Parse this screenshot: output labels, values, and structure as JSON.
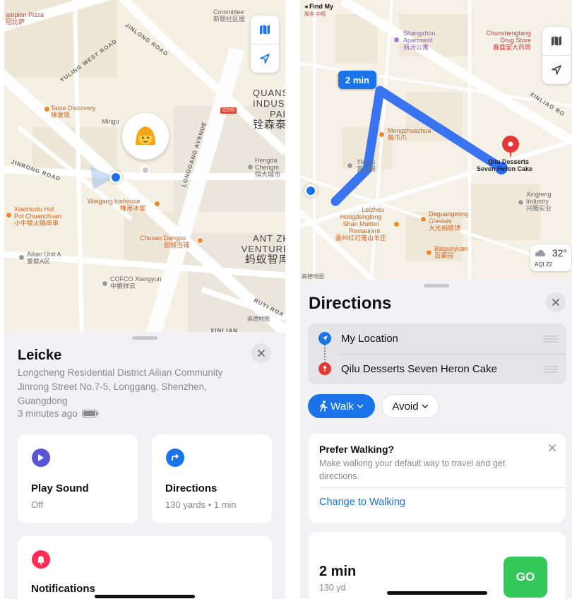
{
  "left": {
    "map": {
      "labels": {
        "pizza": "ampion Pizza",
        "pizza_cn": "冠比萨",
        "committee": "Committee",
        "committee_cn": "新联社区居",
        "yuling_road": "YULING WEST ROAD",
        "jinlong_road": "JINLONG ROAD",
        "taste_discovery": "Taste Discovery",
        "taste_discovery_cn": "味发现",
        "mingu": "Mingu",
        "road_badge": "G205",
        "longgang_ave": "LONGGANG AVENUE",
        "quans": "QUANS",
        "indus": "INDUS",
        "pai": "PAI",
        "quans_cn": "铨森泰",
        "hengda": "Hengda",
        "hengda_2": "Chengm",
        "hengda_cn": "恒大城市",
        "jinrong_road": "JINRONG ROAD",
        "weigang": "Weigang Icehouse",
        "weigang_cn": "唯港冰室",
        "xiaoniudu": "Xiaoniudu Hot",
        "xiaoniudu_2": "Pot Chuanchuan",
        "xiaoniudu_cn": "小牛犊火锅串串",
        "chusao": "Chusao Dangpu",
        "chusao_cn": "厨嫂当铺",
        "ailian": "Ailian Unit A",
        "ailian_cn": "爱联A区",
        "antzh": "ANT ZH",
        "venture": "VENTURE",
        "ant_cn": "蚂蚁智库",
        "cofco": "COFCO Xiangyun",
        "cofco_cn": "中粮祥云",
        "ruyi_road": "RUYI ROA",
        "xinlian": "XINLIAN",
        "attribution": "高德地图"
      }
    },
    "device": {
      "name": "Leicke",
      "address": "Longcheng Residential District Ailian Community Jinrong Street No.7-5, Longgang, Shenzhen, Guangdong",
      "time": "3 minutes ago"
    },
    "cards": {
      "play_sound": {
        "title": "Play Sound",
        "sub": "Off"
      },
      "directions": {
        "title": "Directions",
        "sub": "130 yards • 1 min"
      },
      "notifications": {
        "title": "Notifications"
      }
    },
    "colors": {
      "accent": "#1a73e8",
      "sound": "#5856d6",
      "notify": "#ff2d55"
    }
  },
  "right": {
    "map": {
      "back": "◂ Find My",
      "back_sub": "服务·中枢",
      "labels": {
        "shangzhou": "Shangzhou",
        "shangzhou_2": "Apartment",
        "shangzhou_cn": "商洲公寓",
        "chunsheng": "Chunshengtang",
        "chunsheng_2": "Drug Store",
        "chunsheng_cn": "春盛堂大药房",
        "xinliao_road": "XINLIAO RO",
        "mengzhua": "Mengzhuazhua",
        "mengzhua_cn": "萌爪爪",
        "qilu": "Qilu Desserts",
        "qilu_2": "Seven Heron Cake",
        "yixin": "Yixinju",
        "yixin_cn": "宜欣居",
        "xingteng": "Xingteng",
        "xingteng_2": "Industry",
        "xingteng_cn": "兴腾实业",
        "leizhou": "Leizhou",
        "leizhou_2": "Hongdenglong",
        "leizhou_3": "Shan Mutton",
        "leizhou_4": "Restaurant",
        "leizhou_cn": "雷州红灯笼山羊庄",
        "daguang": "Daguangming",
        "daguang_2": "Glasses",
        "daguang_cn": "大光明眼镜",
        "baiguo": "Baiguoyuan",
        "baiguo_cn": "百果园",
        "attribution": "高德地图"
      },
      "time_badge": "2 min",
      "weather": {
        "temp": "32°",
        "aqi": "AQI 22"
      }
    },
    "directions": {
      "title": "Directions",
      "from": "My Location",
      "to": "Qilu Desserts Seven Heron Cake",
      "walk": "Walk",
      "avoid": "Avoid",
      "tip": {
        "title": "Prefer Walking?",
        "body": "Make walking your default way to travel and get directions.",
        "link": "Change to Walking"
      },
      "route": {
        "time": "2 min",
        "distance": "130 yd",
        "go": "GO"
      }
    },
    "colors": {
      "route": "#2f6df0",
      "go": "#34c759",
      "destination": "#e53935"
    }
  }
}
